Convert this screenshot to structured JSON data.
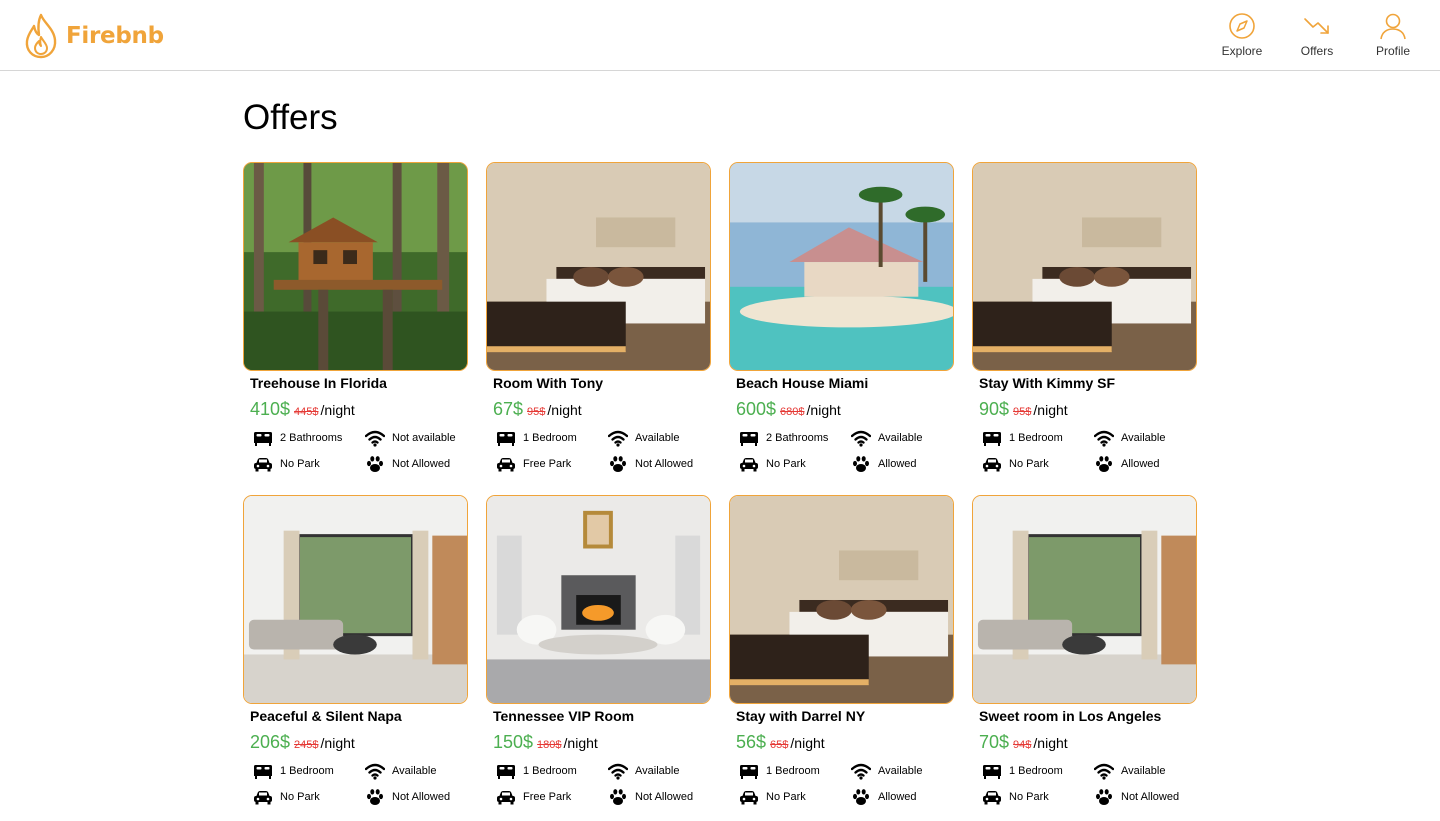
{
  "app": {
    "name": "Firebnb",
    "brand_color": "#f0a43a"
  },
  "nav": [
    {
      "label": "Explore",
      "icon": "compass-icon"
    },
    {
      "label": "Offers",
      "icon": "trend-down-icon"
    },
    {
      "label": "Profile",
      "icon": "person-icon"
    }
  ],
  "page": {
    "title": "Offers"
  },
  "colors": {
    "price": "#4caf50",
    "old_price": "#e53935",
    "card_border": "#f0a43a"
  },
  "listings": [
    {
      "title": "Treehouse In Florida",
      "price": "410$",
      "old_price": "445$",
      "unit": "/night",
      "rooms": "2 Bathrooms",
      "wifi": "Not available",
      "parking": "No Park",
      "pets": "Not Allowed",
      "photo": "treehouse-photo"
    },
    {
      "title": "Room With Tony",
      "price": "67$",
      "old_price": "95$",
      "unit": "/night",
      "rooms": "1 Bedroom",
      "wifi": "Available",
      "parking": "Free Park",
      "pets": "Not Allowed",
      "photo": "bedroom-photo"
    },
    {
      "title": "Beach House Miami",
      "price": "600$",
      "old_price": "680$",
      "unit": "/night",
      "rooms": "2 Bathrooms",
      "wifi": "Available",
      "parking": "No Park",
      "pets": "Allowed",
      "photo": "beach-house-photo"
    },
    {
      "title": "Stay With Kimmy SF",
      "price": "90$",
      "old_price": "95$",
      "unit": "/night",
      "rooms": "1 Bedroom",
      "wifi": "Available",
      "parking": "No Park",
      "pets": "Allowed",
      "photo": "bedroom-photo"
    },
    {
      "title": "Peaceful & Silent Napa",
      "price": "206$",
      "old_price": "245$",
      "unit": "/night",
      "rooms": "1 Bedroom",
      "wifi": "Available",
      "parking": "No Park",
      "pets": "Not Allowed",
      "photo": "living-room-photo"
    },
    {
      "title": "Tennessee VIP Room",
      "price": "150$",
      "old_price": "180$",
      "unit": "/night",
      "rooms": "1 Bedroom",
      "wifi": "Available",
      "parking": "Free Park",
      "pets": "Not Allowed",
      "photo": "fireplace-room-photo"
    },
    {
      "title": "Stay with Darrel NY",
      "price": "56$",
      "old_price": "65$",
      "unit": "/night",
      "rooms": "1 Bedroom",
      "wifi": "Available",
      "parking": "No Park",
      "pets": "Allowed",
      "photo": "bedroom-photo"
    },
    {
      "title": "Sweet room in Los Angeles",
      "price": "70$",
      "old_price": "94$",
      "unit": "/night",
      "rooms": "1 Bedroom",
      "wifi": "Available",
      "parking": "No Park",
      "pets": "Not Allowed",
      "photo": "living-room-photo"
    }
  ]
}
